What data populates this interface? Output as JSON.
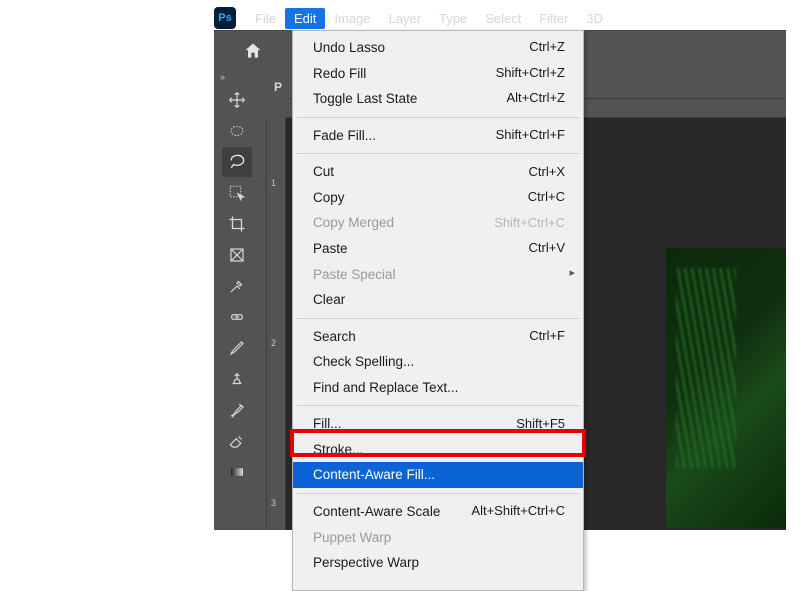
{
  "app": {
    "logo_text": "Ps"
  },
  "menubar": {
    "items": [
      "File",
      "Edit",
      "Image",
      "Layer",
      "Type",
      "Select",
      "Filter",
      "3D"
    ],
    "active_index": 1
  },
  "tabstrip": {
    "visible_label_fragment": "P"
  },
  "ruler_v": {
    "marks": [
      "1",
      "2",
      "3"
    ]
  },
  "edit_menu": {
    "groups": [
      [
        {
          "label": "Undo Lasso",
          "shortcut": "Ctrl+Z",
          "enabled": true
        },
        {
          "label": "Redo Fill",
          "shortcut": "Shift+Ctrl+Z",
          "enabled": true
        },
        {
          "label": "Toggle Last State",
          "shortcut": "Alt+Ctrl+Z",
          "enabled": true
        }
      ],
      [
        {
          "label": "Fade Fill...",
          "shortcut": "Shift+Ctrl+F",
          "enabled": true
        }
      ],
      [
        {
          "label": "Cut",
          "shortcut": "Ctrl+X",
          "enabled": true
        },
        {
          "label": "Copy",
          "shortcut": "Ctrl+C",
          "enabled": true
        },
        {
          "label": "Copy Merged",
          "shortcut": "Shift+Ctrl+C",
          "enabled": false
        },
        {
          "label": "Paste",
          "shortcut": "Ctrl+V",
          "enabled": true
        },
        {
          "label": "Paste Special",
          "shortcut": "",
          "enabled": false,
          "submenu": true
        },
        {
          "label": "Clear",
          "shortcut": "",
          "enabled": true
        }
      ],
      [
        {
          "label": "Search",
          "shortcut": "Ctrl+F",
          "enabled": true
        },
        {
          "label": "Check Spelling...",
          "shortcut": "",
          "enabled": true
        },
        {
          "label": "Find and Replace Text...",
          "shortcut": "",
          "enabled": true
        }
      ],
      [
        {
          "label": "Fill...",
          "shortcut": "Shift+F5",
          "enabled": true
        },
        {
          "label": "Stroke...",
          "shortcut": "",
          "enabled": true
        },
        {
          "label": "Content-Aware Fill...",
          "shortcut": "",
          "enabled": true,
          "highlight": true
        }
      ],
      [
        {
          "label": "Content-Aware Scale",
          "shortcut": "Alt+Shift+Ctrl+C",
          "enabled": true
        },
        {
          "label": "Puppet Warp",
          "shortcut": "",
          "enabled": false
        },
        {
          "label": "Perspective Warp",
          "shortcut": "",
          "enabled": true
        }
      ]
    ]
  },
  "tools": [
    {
      "name": "move-tool"
    },
    {
      "name": "marquee-ellipse-tool"
    },
    {
      "name": "lasso-tool",
      "selected": true
    },
    {
      "name": "object-selection-tool"
    },
    {
      "name": "crop-tool"
    },
    {
      "name": "frame-tool"
    },
    {
      "name": "eyedropper-tool"
    },
    {
      "name": "healing-brush-tool"
    },
    {
      "name": "brush-tool"
    },
    {
      "name": "clone-stamp-tool"
    },
    {
      "name": "history-brush-tool"
    },
    {
      "name": "eraser-tool"
    },
    {
      "name": "gradient-tool"
    }
  ]
}
